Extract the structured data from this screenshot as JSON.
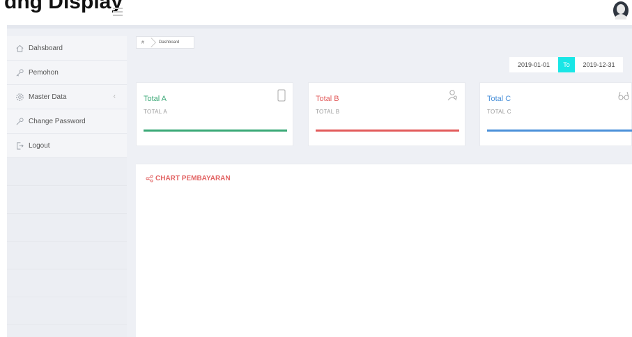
{
  "app": {
    "brand_text": "dng Display"
  },
  "breadcrumb": {
    "home_glyph": "#",
    "current": "Dashboard"
  },
  "sidebar": {
    "items": [
      {
        "label": "Dahsboard",
        "icon": "home-icon"
      },
      {
        "label": "Pemohon",
        "icon": "key-icon"
      },
      {
        "label": "Master Data",
        "icon": "gear-icon",
        "caret": "‹"
      },
      {
        "label": "Change Password",
        "icon": "key-icon"
      },
      {
        "label": "Logout",
        "icon": "logout-icon"
      }
    ]
  },
  "daterange": {
    "from": "2019-01-01",
    "to_label": "To",
    "to": "2019-12-31",
    "to_color": "#19e6e6"
  },
  "cards": [
    {
      "title": "Total A",
      "subtitle": "TOTAL A",
      "color": "#3aa876",
      "icon": "mobile-icon"
    },
    {
      "title": "Total B",
      "subtitle": "TOTAL B",
      "color": "#e25a5a",
      "icon": "users-icon"
    },
    {
      "title": "Total C",
      "subtitle": "TOTAL C",
      "color": "#4a90d9",
      "icon": "glasses-icon"
    }
  ],
  "chart": {
    "title": "CHART PEMBAYARAN",
    "icon": "share-icon",
    "color": "#e26363"
  }
}
